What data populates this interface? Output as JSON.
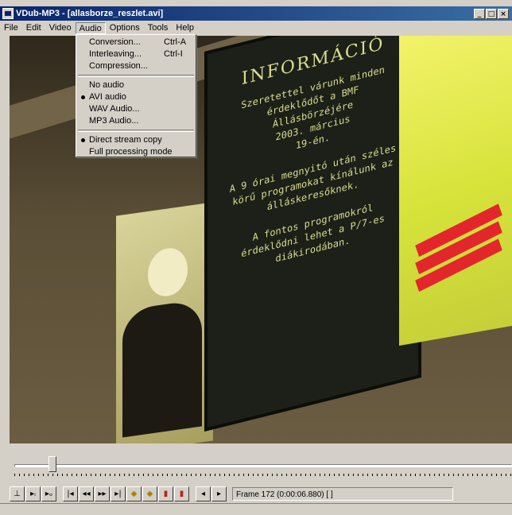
{
  "window": {
    "title": "VDub-MP3 - [allasborze_reszlet.avi]",
    "controls": {
      "minimize": "_",
      "restore": "□",
      "close": "×"
    }
  },
  "menubar": {
    "items": [
      "File",
      "Edit",
      "Video",
      "Audio",
      "Options",
      "Tools",
      "Help"
    ],
    "active": "Audio"
  },
  "audio_menu": {
    "group1": [
      {
        "label": "Conversion...",
        "shortcut": "Ctrl-A"
      },
      {
        "label": "Interleaving...",
        "shortcut": "Ctrl-I"
      },
      {
        "label": "Compression...",
        "shortcut": ""
      }
    ],
    "group2": [
      {
        "label": "No audio",
        "checked": false
      },
      {
        "label": "AVI audio",
        "checked": true
      },
      {
        "label": "WAV Audio...",
        "checked": false
      },
      {
        "label": "MP3 Audio...",
        "checked": false
      }
    ],
    "group3": [
      {
        "label": "Direct stream copy",
        "checked": true
      },
      {
        "label": "Full processing mode",
        "checked": false
      }
    ]
  },
  "video_frame": {
    "board_title": "INFORMÁCIÓ",
    "board_lines": [
      "Szeretettel várunk minden",
      "érdeklődőt a BMF",
      "Állásbörzéjére",
      "2003. március",
      "19-én.",
      "",
      "A 9 órai megnyitó után széles",
      "körű programokat kínálunk az",
      "álláskeresőknek.",
      "",
      "A fontos programokról",
      "érdeklődni lehet a P/7-es",
      "diákirodában."
    ]
  },
  "position": {
    "fraction": 0.07
  },
  "toolbar": {
    "buttons": [
      {
        "name": "stop-button",
        "glyph": "⊥"
      },
      {
        "name": "play-input-button",
        "glyph": "▸ᵢ"
      },
      {
        "name": "play-output-button",
        "glyph": "▸ₒ"
      },
      {
        "name": "start-button",
        "glyph": "|◂"
      },
      {
        "name": "prev-frame-button",
        "glyph": "◂◂"
      },
      {
        "name": "next-frame-button",
        "glyph": "▸▸"
      },
      {
        "name": "end-button",
        "glyph": "▸|"
      },
      {
        "name": "prev-key-button",
        "glyph": "◆"
      },
      {
        "name": "next-key-button",
        "glyph": "◆"
      },
      {
        "name": "scene-prev-button",
        "glyph": "▮"
      },
      {
        "name": "scene-next-button",
        "glyph": "▮"
      },
      {
        "name": "mark-in-button",
        "glyph": "◂"
      },
      {
        "name": "mark-out-button",
        "glyph": "▸"
      }
    ],
    "frame_text": "Frame 172 (0:00:06.880) [ ]"
  }
}
